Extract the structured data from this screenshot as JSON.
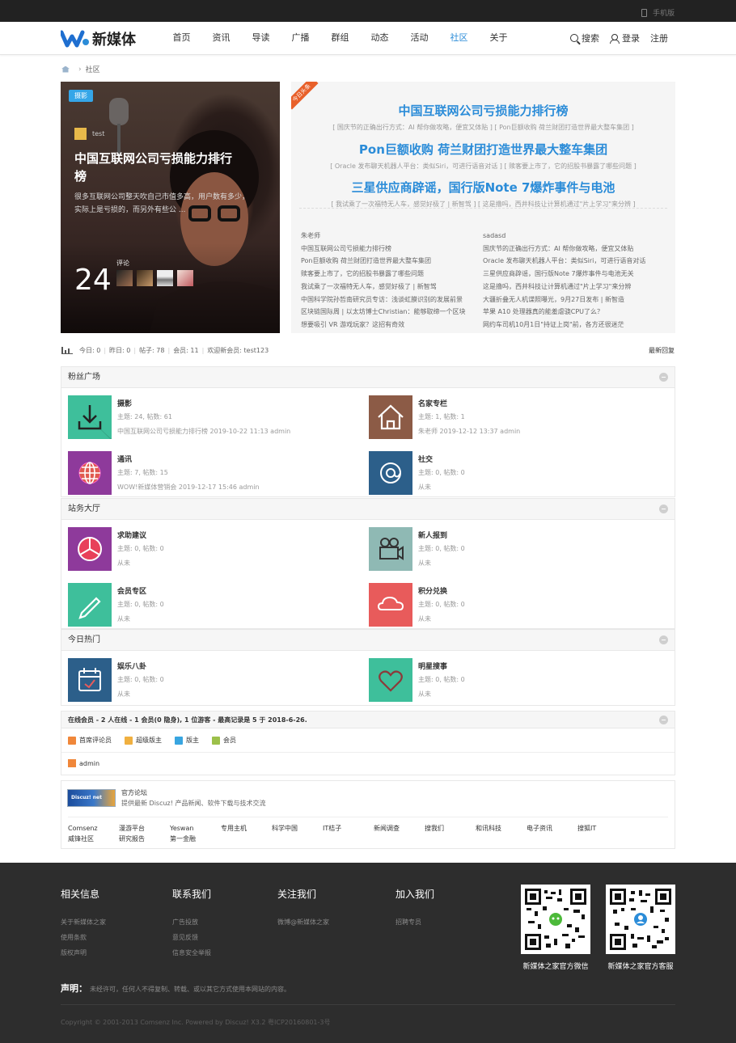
{
  "topbar": {
    "mobile_label": "手机版"
  },
  "brand": {
    "name": "新媒体",
    "accent": "#2b8cd8"
  },
  "nav": {
    "items": [
      "首页",
      "资讯",
      "导读",
      "广播",
      "群组",
      "动态",
      "活动",
      "社区",
      "关于"
    ],
    "active": "社区"
  },
  "header_right": {
    "search": "搜索",
    "login": "登录",
    "register": "注册"
  },
  "breadcrumb": {
    "current": "社区"
  },
  "hero": {
    "tag": "摄影",
    "author": "test",
    "title": "中国互联网公司亏损能力排行榜",
    "desc": "很多互联网公司整天吹自己市值多高，用户数有多少，实际上是亏损的，而另外有些公 ...",
    "count": "24",
    "count_label": "评论"
  },
  "headlines": {
    "ribbon": "今日头条",
    "items": [
      {
        "title": "中国互联网公司亏损能力排行榜",
        "sub": "[ 国庆节的正确出行方式：AI 帮你做攻略，便宜又体贴 ]  [ Pon巨额收购 荷兰财团打造世界最大整车集团 ]"
      },
      {
        "title": "Pon巨额收购 荷兰财团打造世界最大整车集团",
        "sub": "[ Oracle 发布聊天机器人平台：类似Siri，可进行语音对话 ]  [ 赎客要上市了，它的招股书暴露了哪些问题 ]"
      },
      {
        "title": "三星供应商辟谣，国行版Note 7爆炸事件与电池",
        "sub": "[ 我试乘了一次福特无人车，感觉好极了 | 新智驾 ]  [ 这是撸吗，西井科技让计算机通过\"片上学习\"来分辨 ]"
      }
    ],
    "left_col": [
      "朱老师",
      "中国互联网公司亏损能力排行榜",
      "Pon巨额收购 荷兰财团打造世界最大整车集团",
      "赎客要上市了，它的招股书暴露了哪些问题",
      "我试乘了一次福特无人车，感觉好极了 | 新智驾",
      "中国科学院孙哲南研究员专访：浅谈虹膜识别的发展前景",
      "区块链国际周 | 以太坊博士Christian：能够取缔一个区块",
      "想要吸引 VR 游戏玩家？这招有奇效"
    ],
    "right_col": [
      "sadasd",
      "国庆节的正确出行方式：AI 帮你做攻略，便宜又体贴",
      "Oracle 发布聊天机器人平台：类似Siri，可进行语音对话",
      "三星供应商辟谣，国行版Note 7爆炸事件与电池无关",
      "这是撸吗，西井科技让计算机通过\"片上学习\"来分辨",
      "大疆折叠无人机谍照曝光，9月27日发布 | 新智造",
      "苹果 A10 处理器真的能羞虐骁CPU了么？",
      "网约车司机10月1日\"持证上岗\"前，各方还很迷茫"
    ]
  },
  "stats": {
    "today": "今日: 0",
    "yesterday": "昨日: 0",
    "posts": "帖子: 78",
    "members": "会员: 11",
    "welcome": "欢迎新会员: test123",
    "latest": "最新回复"
  },
  "sections": [
    {
      "title": "粉丝广场",
      "forums": [
        {
          "name": "摄影",
          "counts": "主题: 24, 帖数: 61",
          "last": "中国互联网公司亏损能力排行榜 2019-10-22 11:13 admin",
          "color": "#3ebf9b",
          "icon": "download-icon"
        },
        {
          "name": "名家专栏",
          "counts": "主题: 1, 帖数: 1",
          "last": "朱老师 2019-12-12 13:37 admin",
          "color": "#8c5b46",
          "icon": "home-icon"
        },
        {
          "name": "通讯",
          "counts": "主题: 7, 帖数: 15",
          "last": "WOW!新媒体营销会 2019-12-17 15:46 admin",
          "color": "#8e3a9b",
          "icon": "globe-icon"
        },
        {
          "name": "社交",
          "counts": "主题: 0, 帖数: 0",
          "last": "从未",
          "color": "#2c5f8a",
          "icon": "at-icon"
        }
      ]
    },
    {
      "title": "站务大厅",
      "forums": [
        {
          "name": "求助建议",
          "counts": "主题: 0, 帖数: 0",
          "last": "从未",
          "color": "#8e3a9b",
          "icon": "aperture-icon"
        },
        {
          "name": "新人报到",
          "counts": "主题: 0, 帖数: 0",
          "last": "从未",
          "color": "#8fb9b4",
          "icon": "camera-icon"
        },
        {
          "name": "会员专区",
          "counts": "主题: 0, 帖数: 0",
          "last": "从未",
          "color": "#3ebf9b",
          "icon": "pencil-icon"
        },
        {
          "name": "积分兑换",
          "counts": "主题: 0, 帖数: 0",
          "last": "从未",
          "color": "#e85b5b",
          "icon": "cloud-icon"
        }
      ]
    },
    {
      "title": "今日热门",
      "forums": [
        {
          "name": "娱乐八卦",
          "counts": "主题: 0, 帖数: 0",
          "last": "从未",
          "color": "#2c5f8a",
          "icon": "calendar-icon"
        },
        {
          "name": "明星搜事",
          "counts": "主题: 0, 帖数: 0",
          "last": "从未",
          "color": "#3ebf9b",
          "icon": "heart-icon"
        }
      ]
    }
  ],
  "online": {
    "summary_bold": "在线会员",
    "summary": " - 2 人在线 - 1 会员(0 隐身), 1 位游客 - 最高记录是 5 于 2018-6-26.",
    "legend": [
      {
        "label": "首席评论员",
        "color": "#f0873a"
      },
      {
        "label": "超级版主",
        "color": "#f0b040"
      },
      {
        "label": "版主",
        "color": "#38a5e0"
      },
      {
        "label": "会员",
        "color": "#9cc04a"
      }
    ],
    "user": "admin"
  },
  "friend_links": {
    "logo_text": "Discuz! net",
    "title": "官方论坛",
    "desc": "提供最新 Discuz! 产品新闻、软件下载与技术交流",
    "items": [
      "Comsenz",
      "漫游平台",
      "Yeswan",
      "专用主机",
      "科学中国",
      "IT桔子",
      "新闻调查",
      "搜我们",
      "和讯科技",
      "电子资讯",
      "搜狐IT",
      "威锋社区",
      "研究报告",
      "第一金融"
    ]
  },
  "footer": {
    "cols": [
      {
        "title": "相关信息",
        "links": [
          "关于新媒体之家",
          "使用条款",
          "版权声明"
        ]
      },
      {
        "title": "联系我们",
        "links": [
          "广告投放",
          "意见反馈",
          "信息安全举报"
        ]
      },
      {
        "title": "关注我们",
        "links": [
          "微博@新媒体之家"
        ]
      },
      {
        "title": "加入我们",
        "links": [
          "招聘专员"
        ]
      }
    ],
    "qr1": "新媒体之家官方微信",
    "qr2": "新媒体之家官方客服",
    "decl_label": "声明：",
    "decl": "未经许可，任何人不得复制、转载、或以其它方式使用本网站的内容。",
    "copyright": "Copyright © 2001-2013 Comsenz Inc. Powered by Discuz! X3.2 粤ICP20160801-3号"
  }
}
